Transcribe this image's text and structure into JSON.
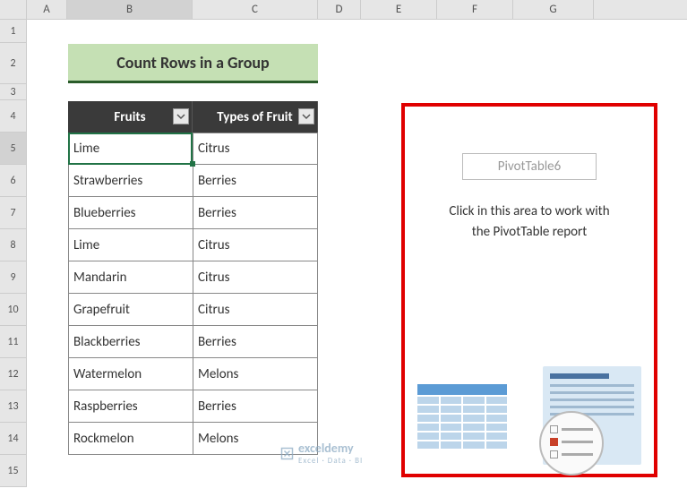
{
  "columns": [
    "A",
    "B",
    "C",
    "D",
    "E",
    "F",
    "G"
  ],
  "rows": [
    "1",
    "2",
    "3",
    "4",
    "5",
    "6",
    "7",
    "8",
    "9",
    "10",
    "11",
    "12",
    "13",
    "14",
    "15"
  ],
  "title": "Count Rows in a Group",
  "table": {
    "headers": {
      "fruits": "Fruits",
      "types": "Types of Fruit"
    },
    "data": [
      {
        "fruit": "Lime",
        "type": "Citrus"
      },
      {
        "fruit": "Strawberries",
        "type": "Berries"
      },
      {
        "fruit": "Blueberries",
        "type": "Berries"
      },
      {
        "fruit": "Lime",
        "type": "Citrus"
      },
      {
        "fruit": "Mandarin",
        "type": "Citrus"
      },
      {
        "fruit": "Grapefruit",
        "type": "Citrus"
      },
      {
        "fruit": "Blackberries",
        "type": "Berries"
      },
      {
        "fruit": "Watermelon",
        "type": "Melons"
      },
      {
        "fruit": "Raspberries",
        "type": "Berries"
      },
      {
        "fruit": "Rockmelon",
        "type": "Melons"
      }
    ]
  },
  "pivot": {
    "name": "PivotTable6",
    "message_line1": "Click in this area to work with",
    "message_line2": "the PivotTable report"
  },
  "watermark": {
    "brand": "exceldemy",
    "tagline": "Excel · Data · BI"
  }
}
